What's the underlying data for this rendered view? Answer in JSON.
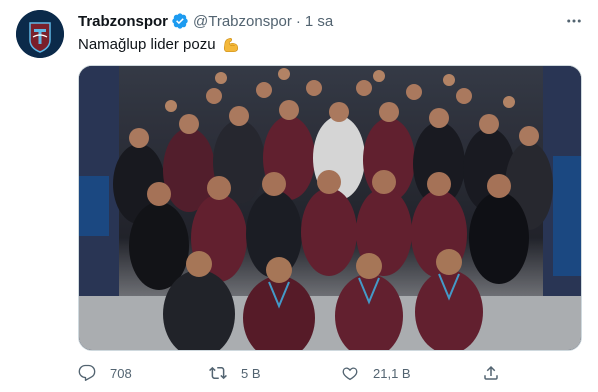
{
  "tweet": {
    "name": "Trabzonspor",
    "handle": "@Trabzonspor",
    "separator": "·",
    "time": "1 sa",
    "text": "Namağlup lider pozu"
  },
  "actions": {
    "replies": "708",
    "retweets": "5 B",
    "likes": "21,1 B"
  },
  "colors": {
    "verified": "#1d9bf0",
    "secondary_text": "#536471",
    "club_claret": "#7a1f2b",
    "club_navy": "#0b2a4a"
  },
  "icons": [
    "trabzonspor-logo",
    "verified-badge-icon",
    "more-icon",
    "flexed-biceps-emoji",
    "reply-icon",
    "retweet-icon",
    "like-icon",
    "share-icon"
  ]
}
